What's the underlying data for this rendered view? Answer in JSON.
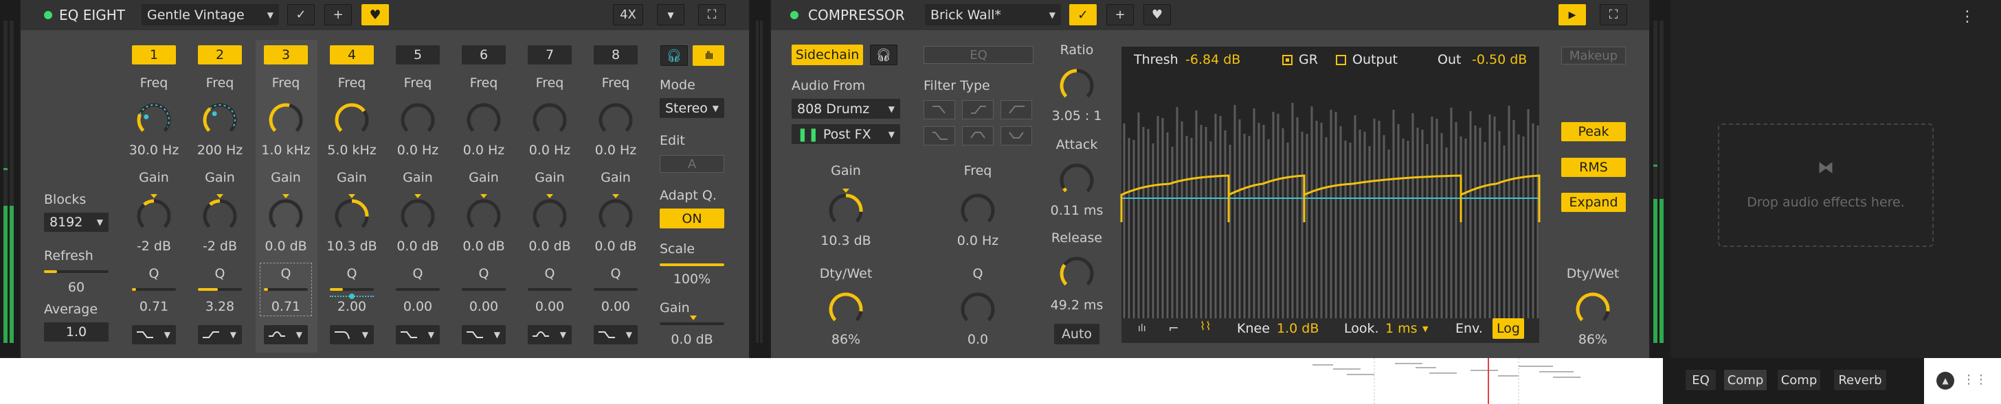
{
  "colors": {
    "accent": "#f8c500",
    "teal": "#3fc3d0",
    "panel": "#464646",
    "header": "#2f2f2f"
  },
  "eq": {
    "title": "EQ EIGHT",
    "preset": "Gentle Vintage",
    "oversample": "4X",
    "bands": [
      {
        "num": "1",
        "active": true,
        "freq_label": "Freq",
        "freq": "30.0 Hz",
        "gain_label": "Gain",
        "gain": "-2 dB",
        "q_label": "Q",
        "q": "0.71",
        "filter_icon": "low-shelf-icon",
        "freq_level": 0.25,
        "gain_level": -0.3,
        "q_level": 0.1
      },
      {
        "num": "2",
        "active": true,
        "freq_label": "Freq",
        "freq": "200 Hz",
        "gain_label": "Gain",
        "gain": "-2 dB",
        "q_label": "Q",
        "q": "3.28",
        "filter_icon": "high-shelf-icon",
        "freq_level": 0.35,
        "gain_level": -0.3,
        "q_level": 0.45
      },
      {
        "num": "3",
        "active": true,
        "freq_label": "Freq",
        "freq": "1.0 kHz",
        "gain_label": "Gain",
        "gain": "0.0 dB",
        "q_label": "Q",
        "q": "0.71",
        "filter_icon": "bell-icon",
        "freq_level": 0.55,
        "gain_level": 0,
        "q_level": 0.1
      },
      {
        "num": "4",
        "active": true,
        "freq_label": "Freq",
        "freq": "5.0 kHz",
        "gain_label": "Gain",
        "gain": "10.3 dB",
        "q_label": "Q",
        "q": "2.00",
        "filter_icon": "low-pass-icon",
        "freq_level": 0.7,
        "gain_level": 0.68,
        "q_level": 0.3
      },
      {
        "num": "5",
        "active": false,
        "freq_label": "Freq",
        "freq": "0.0 Hz",
        "gain_label": "Gain",
        "gain": "0.0 dB",
        "q_label": "Q",
        "q": "0.00",
        "filter_icon": "low-shelf-icon",
        "freq_level": 0,
        "gain_level": 0,
        "q_level": 0
      },
      {
        "num": "6",
        "active": false,
        "freq_label": "Freq",
        "freq": "0.0 Hz",
        "gain_label": "Gain",
        "gain": "0.0 dB",
        "q_label": "Q",
        "q": "0.00",
        "filter_icon": "low-shelf-icon",
        "freq_level": 0,
        "gain_level": 0,
        "q_level": 0
      },
      {
        "num": "7",
        "active": false,
        "freq_label": "Freq",
        "freq": "0.0 Hz",
        "gain_label": "Gain",
        "gain": "0.0 dB",
        "q_label": "Q",
        "q": "0.00",
        "filter_icon": "bell-icon",
        "freq_level": 0,
        "gain_level": 0,
        "q_level": 0
      },
      {
        "num": "8",
        "active": false,
        "freq_label": "Freq",
        "freq": "0.0 Hz",
        "gain_label": "Gain",
        "gain": "0.0 dB",
        "q_label": "Q",
        "q": "0.00",
        "filter_icon": "low-shelf-icon",
        "freq_level": 0,
        "gain_level": 0,
        "q_level": 0
      }
    ],
    "blocks_label": "Blocks",
    "blocks": "8192",
    "refresh_label": "Refresh",
    "refresh": "60",
    "refresh_level": 0.2,
    "average_label": "Average",
    "average": "1.0",
    "mode_label": "Mode",
    "mode": "Stereo",
    "edit_label": "Edit",
    "edit": "A",
    "adaptq_label": "Adapt Q.",
    "adaptq": "ON",
    "scale_label": "Scale",
    "scale": "100%",
    "scale_level": 1.0,
    "gain_label": "Gain",
    "gain": "0.0 dB",
    "gain_level": 0.5
  },
  "comp": {
    "title": "COMPRESSOR",
    "preset": "Brick Wall*",
    "sidechain": "Sidechain",
    "eq_label": "EQ",
    "audio_from_label": "Audio From",
    "audio_from": "808 Drumz",
    "post_fx": "Post FX",
    "filter_type_label": "Filter Type",
    "sc_gain_label": "Gain",
    "sc_gain": "10.3 dB",
    "sc_gain_level": 0.7,
    "sc_freq_label": "Freq",
    "sc_freq": "0.0 Hz",
    "sc_dw_label": "Dty/Wet",
    "sc_dw": "86%",
    "sc_dw_level": 0.86,
    "sc_q_label": "Q",
    "sc_q": "0.0",
    "ratio_label": "Ratio",
    "ratio": "3.05 : 1",
    "ratio_level": 0.5,
    "attack_label": "Attack",
    "attack": "0.11 ms",
    "attack_level": 0.05,
    "release_label": "Release",
    "release": "49.2 ms",
    "release_level": 0.3,
    "auto": "Auto",
    "thresh_label": "Thresh",
    "thresh": "-6.84 dB",
    "gr_label": "GR",
    "output_label": "Output",
    "out_label": "Out",
    "out": "-0.50 dB",
    "knee_label": "Knee",
    "knee": "1.0 dB",
    "look_label": "Look.",
    "look": "1 ms",
    "env_label": "Env.",
    "env": "Log",
    "makeup": "Makeup",
    "peak": "Peak",
    "rms": "RMS",
    "expand": "Expand",
    "dw_label": "Dty/Wet",
    "dw": "86%",
    "dw_level": 0.86
  },
  "dropzone": {
    "text": "Drop audio effects here."
  },
  "chain": [
    "EQ",
    "Comp",
    "Comp",
    "Reverb"
  ]
}
